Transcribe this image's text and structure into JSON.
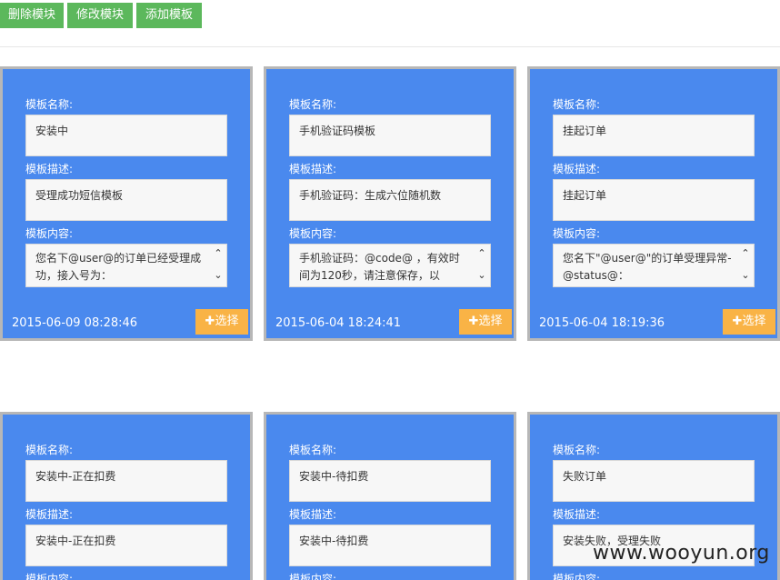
{
  "toolbar": {
    "delete_label": "删除模块",
    "edit_label": "修改模块",
    "add_label": "添加模板"
  },
  "labels": {
    "name": "模板名称:",
    "desc": "模板描述:",
    "content": "模板内容:",
    "select": "选择"
  },
  "cards": [
    {
      "name": "安装中",
      "desc": "受理成功短信模板",
      "content": "您名下@user@的订单已经受理成功，接入号为：",
      "date": "2015-06-09 08:28:46"
    },
    {
      "name": "手机验证码模板",
      "desc": "手机验证码：生成六位随机数",
      "content": "手机验证码：@code@ ，有效时间为120秒，请注意保存，以",
      "date": "2015-06-04 18:24:41"
    },
    {
      "name": "挂起订单",
      "desc": "挂起订单",
      "content": "您名下\"@user@\"的订单受理异常-@status@：",
      "date": "2015-06-04 18:19:36"
    },
    {
      "name": "安装中-正在扣费",
      "desc": "安装中-正在扣费"
    },
    {
      "name": "安装中-待扣费",
      "desc": "安装中-待扣费"
    },
    {
      "name": "失败订单",
      "desc": "安装失败，受理失败"
    }
  ],
  "watermark": "www.wooyun.org"
}
